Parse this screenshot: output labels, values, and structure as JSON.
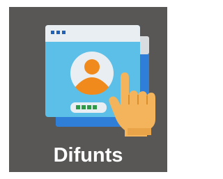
{
  "app": {
    "label": "Difunts",
    "icon": "profile-window-touch-icon",
    "colors": {
      "tile_background": "#585756",
      "window_front": "#5cbfe8",
      "window_back": "#2f7ed8",
      "window_header": "#e9eef2",
      "avatar_body": "#f08a1c",
      "hand": "#f3b45c",
      "dots": "#2e9a48"
    }
  }
}
